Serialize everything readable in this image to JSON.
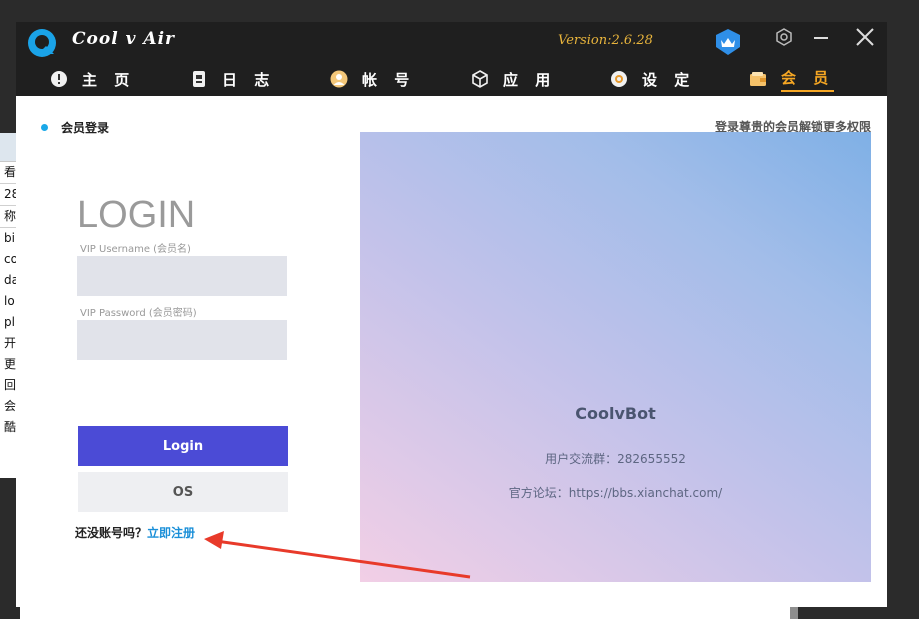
{
  "app": {
    "title": "Cool v Air",
    "version": "Version:2.6.28"
  },
  "nav": {
    "items": [
      {
        "label": "主 页",
        "icon": "info-icon"
      },
      {
        "label": "日 志",
        "icon": "log-icon"
      },
      {
        "label": "帐 号",
        "icon": "account-icon"
      },
      {
        "label": "应 用",
        "icon": "cube-icon"
      },
      {
        "label": "设 定",
        "icon": "settings-icon"
      },
      {
        "label": "会 员",
        "icon": "wallet-icon"
      }
    ],
    "active": "会 员"
  },
  "section": {
    "title": "会员登录",
    "hint": "登录尊贵的会员解锁更多权限"
  },
  "login": {
    "heading": "LOGIN",
    "username_label": "VIP Username (会员名)",
    "username_value": "",
    "password_label": "VIP Password (会员密码)",
    "password_value": "",
    "login_button": "Login",
    "os_button": "OS",
    "register_prompt": "还没账号吗？",
    "register_link": "立即注册"
  },
  "promo": {
    "title": "CoolvBot",
    "group": "用户交流群：282655552",
    "forum": "官方论坛：https://bbs.xianchat.com/"
  },
  "background_window": {
    "rows": [
      "看",
      "28_",
      "称",
      "bi",
      "co",
      "da",
      "lo",
      "pl",
      "开",
      "更",
      "回",
      "会",
      "酷"
    ]
  },
  "colors": {
    "accent": "#4b4bd6",
    "active_nav": "#f5a623",
    "link": "#1a8fd8",
    "version": "#e8b43c"
  }
}
